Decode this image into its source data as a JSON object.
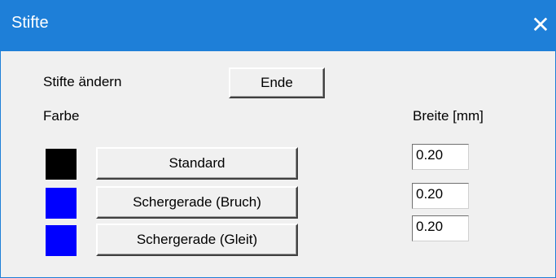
{
  "window": {
    "title": "Stifte",
    "close_symbol": "✕"
  },
  "labels": {
    "change_pens": "Stifte ändern",
    "color": "Farbe",
    "width": "Breite [mm]"
  },
  "end_button": "Ende",
  "pens": [
    {
      "name": "Standard",
      "color": "#000000",
      "width": "0.20"
    },
    {
      "name": "Schergerade (Bruch)",
      "color": "#0000ff",
      "width": "0.20"
    },
    {
      "name": "Schergerade (Gleit)",
      "color": "#0000ff",
      "width": "0.20"
    }
  ],
  "colors": {
    "titlebar": "#1e7fd8",
    "dialog_bg": "#f0f0f0"
  }
}
